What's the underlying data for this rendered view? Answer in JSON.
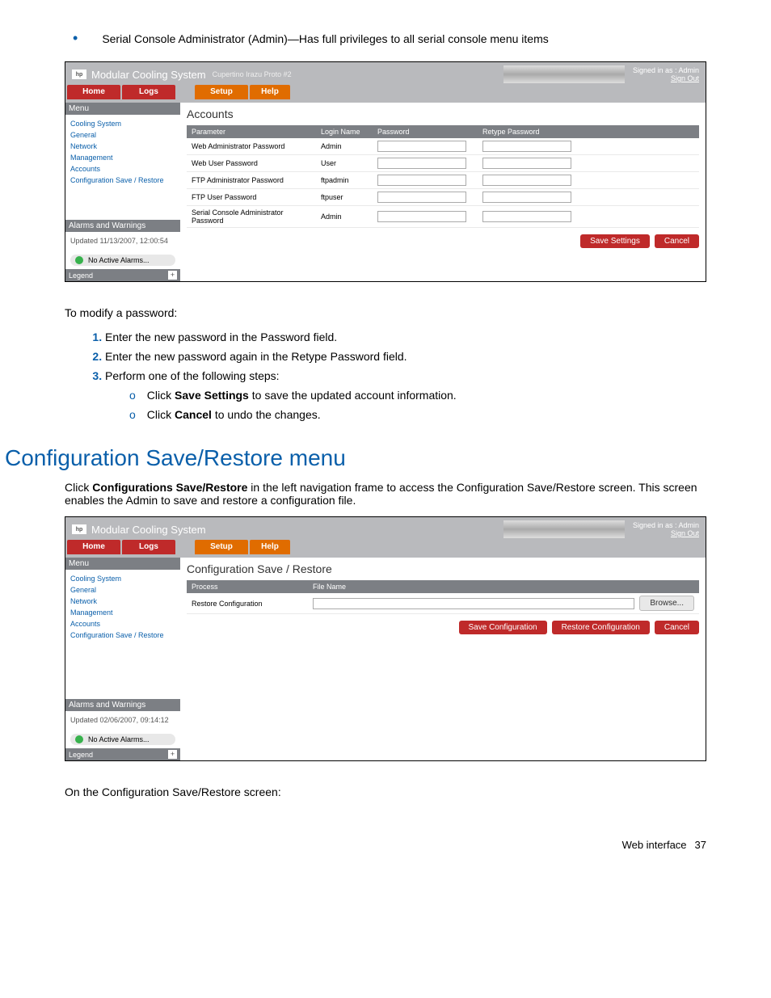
{
  "intro_bullet": "Serial Console Administrator (Admin)—Has full privileges to all serial console menu items",
  "shot1": {
    "hp_logo": "hp",
    "title": "Modular Cooling System",
    "subtitle": "Cupertino Irazu Proto #2",
    "signed_in": "Signed in as : Admin",
    "signout": "Sign Out",
    "tabs": {
      "home": "Home",
      "logs": "Logs",
      "setup": "Setup",
      "help": "Help"
    },
    "menu_hdr": "Menu",
    "menu": [
      "Cooling System",
      "General",
      "Network",
      "Management",
      "Accounts",
      "Configuration Save / Restore"
    ],
    "alarms_hdr": "Alarms and Warnings",
    "alarms_updated": "Updated 11/13/2007, 12:00:54",
    "no_alarms": "No Active Alarms...",
    "legend": "Legend",
    "main_title": "Accounts",
    "cols": {
      "param": "Parameter",
      "login": "Login Name",
      "pw": "Password",
      "retype": "Retype Password"
    },
    "rows": [
      {
        "param": "Web Administrator Password",
        "login": "Admin"
      },
      {
        "param": "Web User Password",
        "login": "User"
      },
      {
        "param": "FTP Administrator Password",
        "login": "ftpadmin"
      },
      {
        "param": "FTP User Password",
        "login": "ftpuser"
      },
      {
        "param": "Serial Console Administrator Password",
        "login": "Admin"
      }
    ],
    "save_btn": "Save Settings",
    "cancel_btn": "Cancel"
  },
  "modify_intro": "To modify a password:",
  "steps": [
    "Enter the new password in the Password field.",
    "Enter the new password again in the Retype Password field.",
    "Perform one of the following steps:"
  ],
  "substeps": [
    {
      "pre": "Click ",
      "bold": "Save Settings",
      "post": " to save the updated account information."
    },
    {
      "pre": "Click ",
      "bold": "Cancel",
      "post": " to undo the changes."
    }
  ],
  "section_heading": "Configuration Save/Restore menu",
  "section_para_pre": "Click ",
  "section_para_bold": "Configurations Save/Restore",
  "section_para_post": " in the left navigation frame to access the Configuration Save/Restore screen. This screen enables the Admin to save and restore a configuration file.",
  "shot2": {
    "hp_logo": "hp",
    "title": "Modular Cooling System",
    "signed_in": "Signed in as : Admin",
    "signout": "Sign Out",
    "tabs": {
      "home": "Home",
      "logs": "Logs",
      "setup": "Setup",
      "help": "Help"
    },
    "menu_hdr": "Menu",
    "menu": [
      "Cooling System",
      "General",
      "Network",
      "Management",
      "Accounts",
      "Configuration Save / Restore"
    ],
    "alarms_hdr": "Alarms and Warnings",
    "alarms_updated": "Updated 02/06/2007, 09:14:12",
    "no_alarms": "No Active Alarms...",
    "legend": "Legend",
    "main_title": "Configuration Save / Restore",
    "cols": {
      "process": "Process",
      "file": "File Name"
    },
    "row_process": "Restore Configuration",
    "browse_btn": "Browse...",
    "save_conf_btn": "Save Configuration",
    "restore_conf_btn": "Restore Configuration",
    "cancel_btn": "Cancel"
  },
  "outro": "On the Configuration Save/Restore screen:",
  "footer_label": "Web interface",
  "footer_page": "37"
}
